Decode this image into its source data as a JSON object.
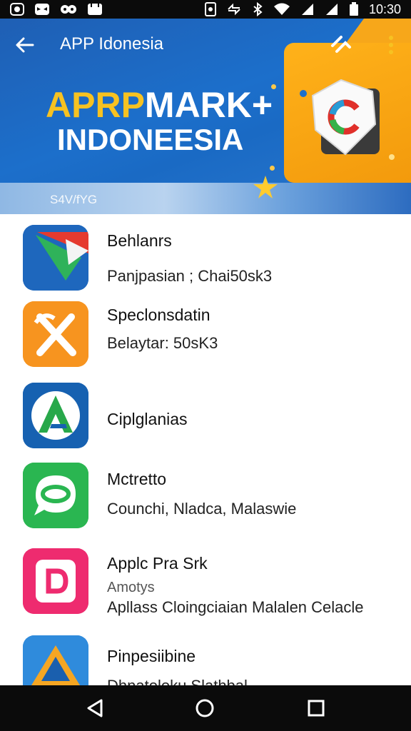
{
  "status_bar": {
    "time": "10:30"
  },
  "toolbar": {
    "title": "APP Idonesia"
  },
  "banner": {
    "title_line1_yellow": "APRP",
    "title_line1_white": "MARK+",
    "title_line2": "INDONEESIA",
    "subtitle": "S4V/fYG"
  },
  "apps": [
    {
      "title": "Behlanrs",
      "subtitle": "Panjpasian ; Chai50sk3",
      "icon": "red-green-blue-arrow-icon"
    },
    {
      "title": "Speclonsdatin",
      "subtitle": "Belaytar: 50sK3",
      "icon": "orange-x-tool-icon"
    },
    {
      "title": "Ciplglanias",
      "subtitle": "",
      "icon": "blue-green-a-icon"
    },
    {
      "title": "Mctretto",
      "subtitle": "Counchi, Nladca, Malaswie",
      "icon": "green-chat-bubble-icon"
    },
    {
      "title": "Applc Pra Srk",
      "subtitle": "Amotys",
      "subtitle2": "Apllass Cloingciaian Malalen Celacle",
      "icon": "pink-d-icon"
    },
    {
      "title": "Pinpesiibine",
      "subtitle": "Dhnatoloku Slathbal",
      "icon": "blue-orange-triangle-icon"
    }
  ],
  "colors": {
    "header_blue": "#1c6fcb",
    "accent_yellow": "#f7c221",
    "accent_orange": "#f7a71a",
    "status_bar": "#0b0b0b"
  }
}
